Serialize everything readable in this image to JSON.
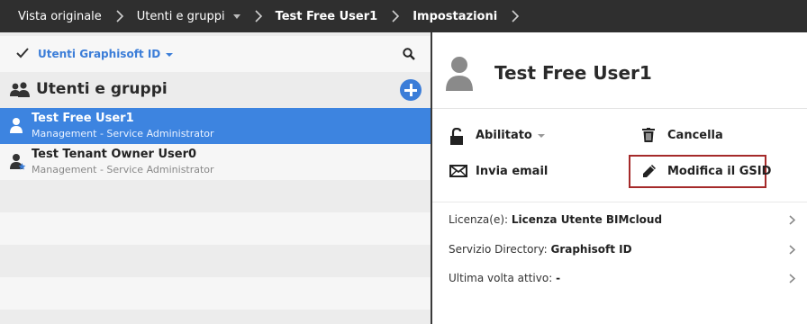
{
  "breadcrumb": {
    "items": [
      {
        "label": "Vista originale",
        "bold": false
      },
      {
        "label": "Utenti e gruppi",
        "bold": false,
        "dropdown": true
      },
      {
        "label": "Test Free User1",
        "bold": true
      },
      {
        "label": "Impostazioni",
        "bold": true
      }
    ]
  },
  "left_panel": {
    "filter_label": "Utenti Graphisoft ID",
    "section_title": "Utenti e gruppi",
    "users": [
      {
        "name": "Test Free User1",
        "role": "Management - Service Administrator",
        "selected": true
      },
      {
        "name": "Test Tenant Owner User0",
        "role": "Management - Service Administrator",
        "selected": false
      }
    ]
  },
  "right_panel": {
    "user_title": "Test Free User1",
    "actions": {
      "enabled_label": "Abilitato",
      "delete_label": "Cancella",
      "send_email_label": "Invia email",
      "edit_gsid_label": "Modifica il GSID"
    },
    "info": {
      "license_label": "Licenza(e):",
      "license_value": "Licenza Utente BIMcloud",
      "directory_label": "Servizio Directory:",
      "directory_value": "Graphisoft ID",
      "last_active_label": "Ultima volta attivo:",
      "last_active_value": "-"
    }
  },
  "colors": {
    "accent": "#3d84e0",
    "highlight_border": "#a52a2a",
    "topbar": "#2f2f2f"
  },
  "icons": [
    "chevron-right-icon",
    "caret-down-icon",
    "checkmark-icon",
    "search-icon",
    "users-group-icon",
    "add-icon",
    "user-icon",
    "user-star-icon",
    "avatar-icon",
    "unlock-icon",
    "trash-icon",
    "envelope-icon",
    "pencil-icon"
  ]
}
